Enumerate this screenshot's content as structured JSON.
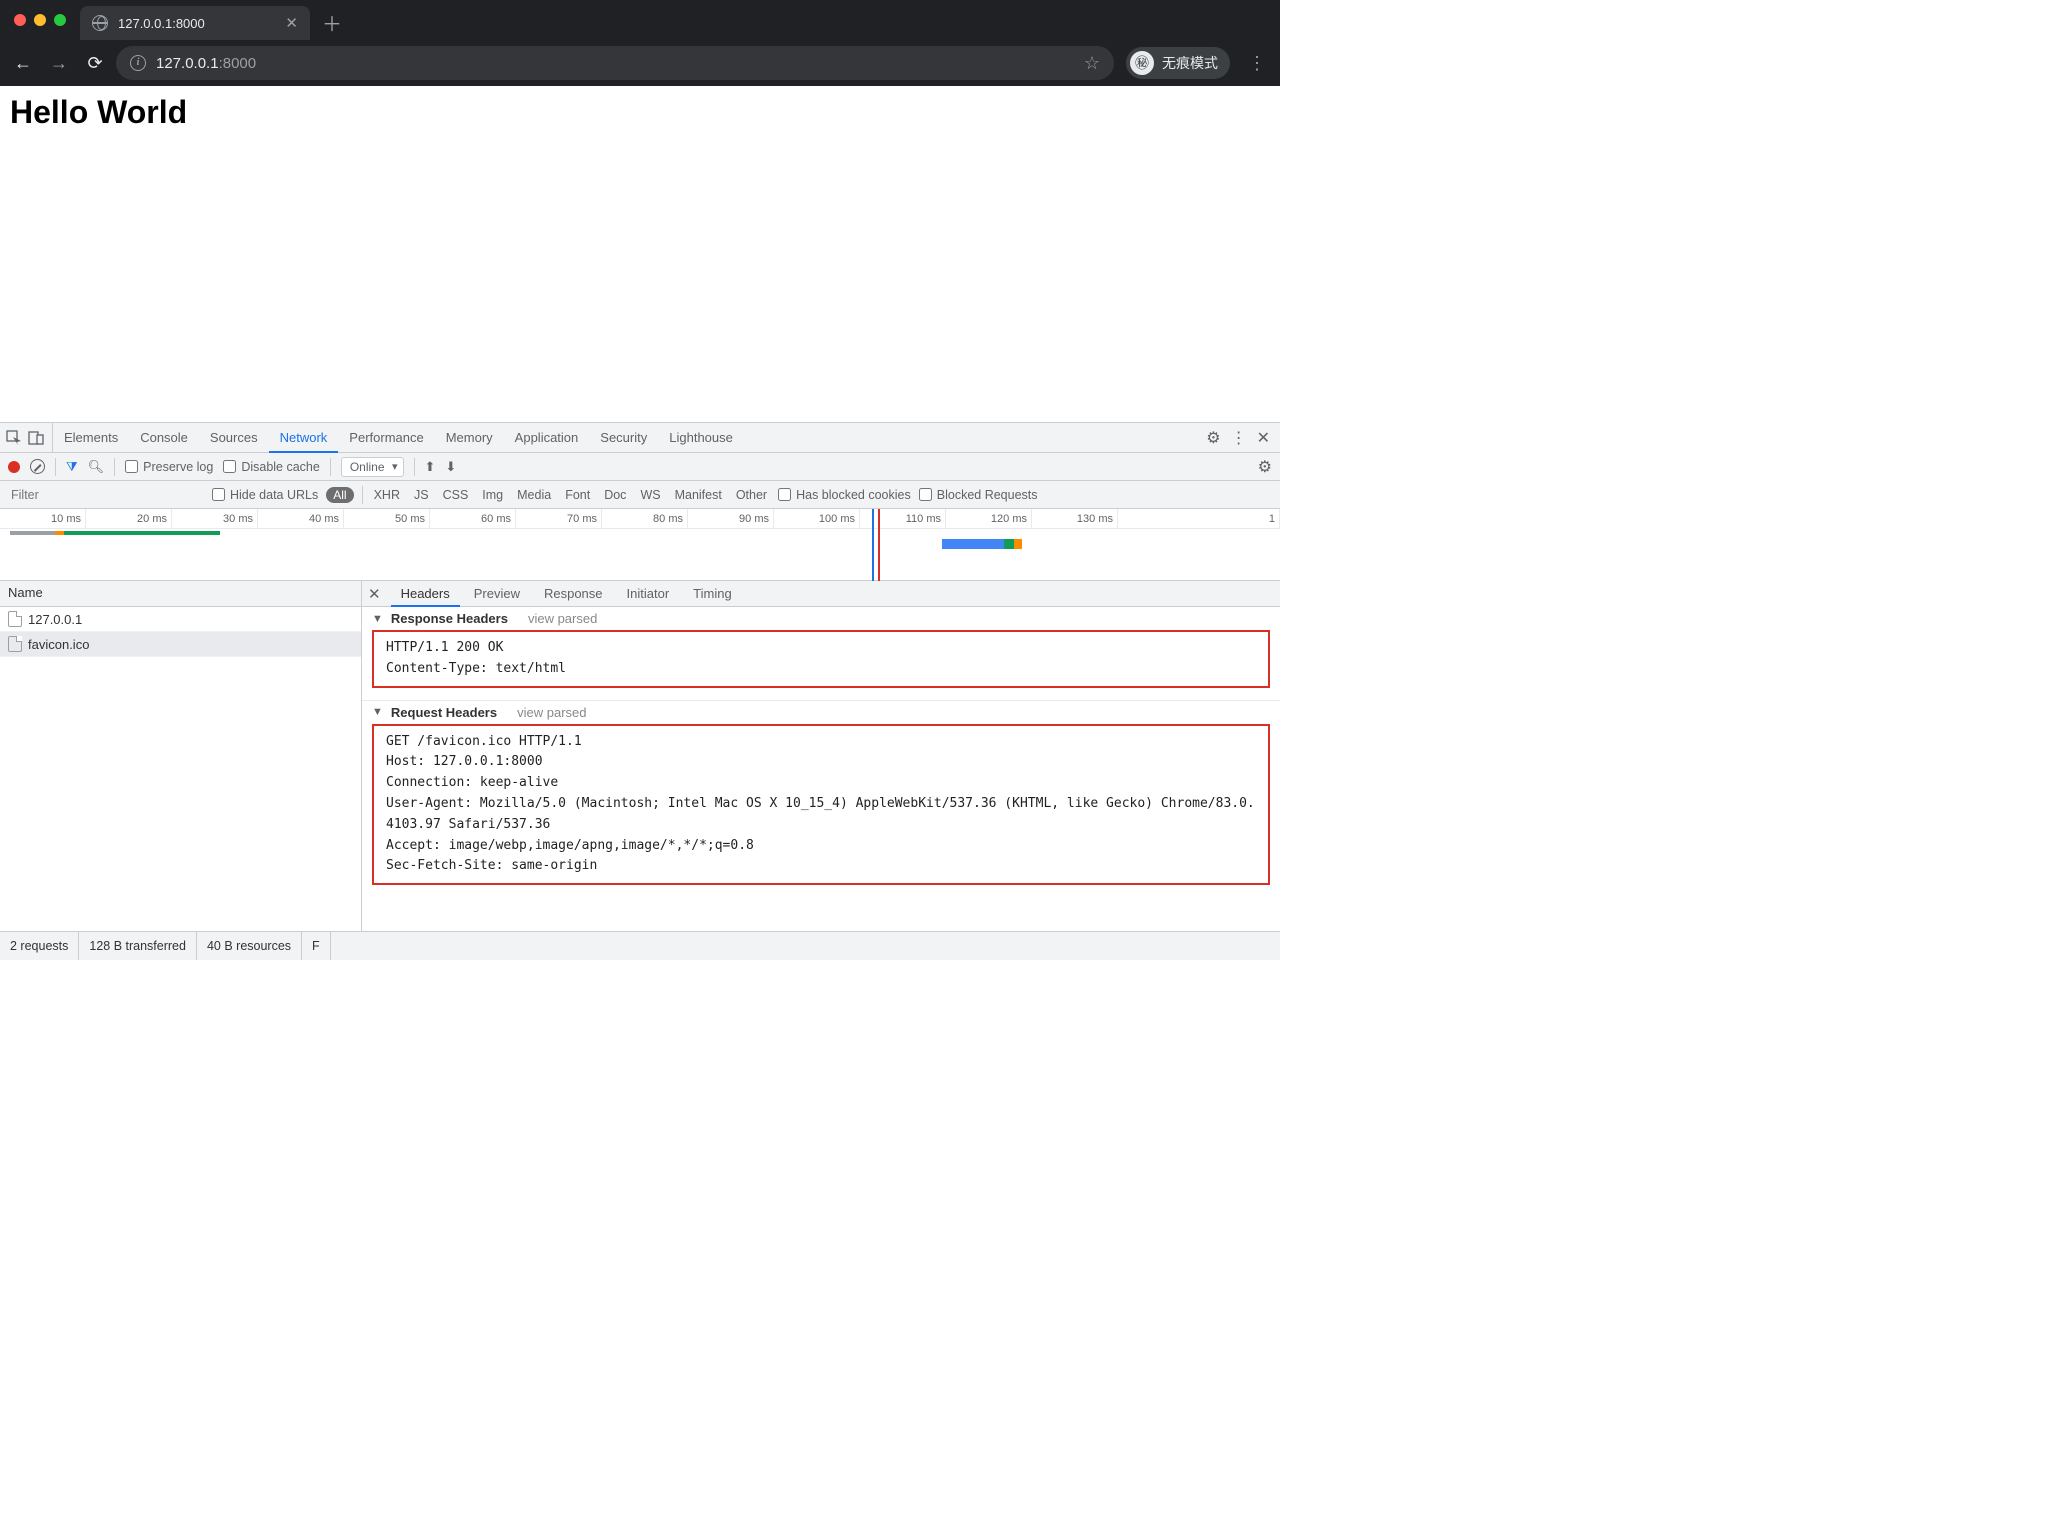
{
  "browser": {
    "tab_title": "127.0.0.1:8000",
    "url_host": "127.0.0.1",
    "url_port": ":8000",
    "incognito_label": "无痕模式"
  },
  "page": {
    "heading": "Hello World"
  },
  "devtools": {
    "tabs": [
      "Elements",
      "Console",
      "Sources",
      "Network",
      "Performance",
      "Memory",
      "Application",
      "Security",
      "Lighthouse"
    ],
    "active_tab": "Network",
    "toolbar": {
      "preserve_log": "Preserve log",
      "disable_cache": "Disable cache",
      "throttle": "Online"
    },
    "filter": {
      "placeholder": "Filter",
      "hide_data_urls": "Hide data URLs",
      "all_label": "All",
      "types": [
        "XHR",
        "JS",
        "CSS",
        "Img",
        "Media",
        "Font",
        "Doc",
        "WS",
        "Manifest",
        "Other"
      ],
      "has_blocked": "Has blocked cookies",
      "blocked_req": "Blocked Requests"
    },
    "timeline_ticks": [
      "10 ms",
      "20 ms",
      "30 ms",
      "40 ms",
      "50 ms",
      "60 ms",
      "70 ms",
      "80 ms",
      "90 ms",
      "100 ms",
      "110 ms",
      "120 ms",
      "130 ms",
      "1"
    ],
    "name_header": "Name",
    "requests": [
      {
        "name": "127.0.0.1",
        "selected": false
      },
      {
        "name": "favicon.ico",
        "selected": true
      }
    ],
    "detail_tabs": [
      "Headers",
      "Preview",
      "Response",
      "Initiator",
      "Timing"
    ],
    "active_detail_tab": "Headers",
    "sections": {
      "response": {
        "title": "Response Headers",
        "view_parsed": "view parsed",
        "lines": "HTTP/1.1 200 OK\nContent-Type: text/html"
      },
      "request": {
        "title": "Request Headers",
        "view_parsed": "view parsed",
        "lines": "GET /favicon.ico HTTP/1.1\nHost: 127.0.0.1:8000\nConnection: keep-alive\nUser-Agent: Mozilla/5.0 (Macintosh; Intel Mac OS X 10_15_4) AppleWebKit/537.36 (KHTML, like Gecko) Chrome/83.0.4103.97 Safari/537.36\nAccept: image/webp,image/apng,image/*,*/*;q=0.8\nSec-Fetch-Site: same-origin"
      }
    },
    "status": {
      "requests": "2 requests",
      "transferred": "128 B transferred",
      "resources": "40 B resources",
      "extra": "F"
    }
  }
}
